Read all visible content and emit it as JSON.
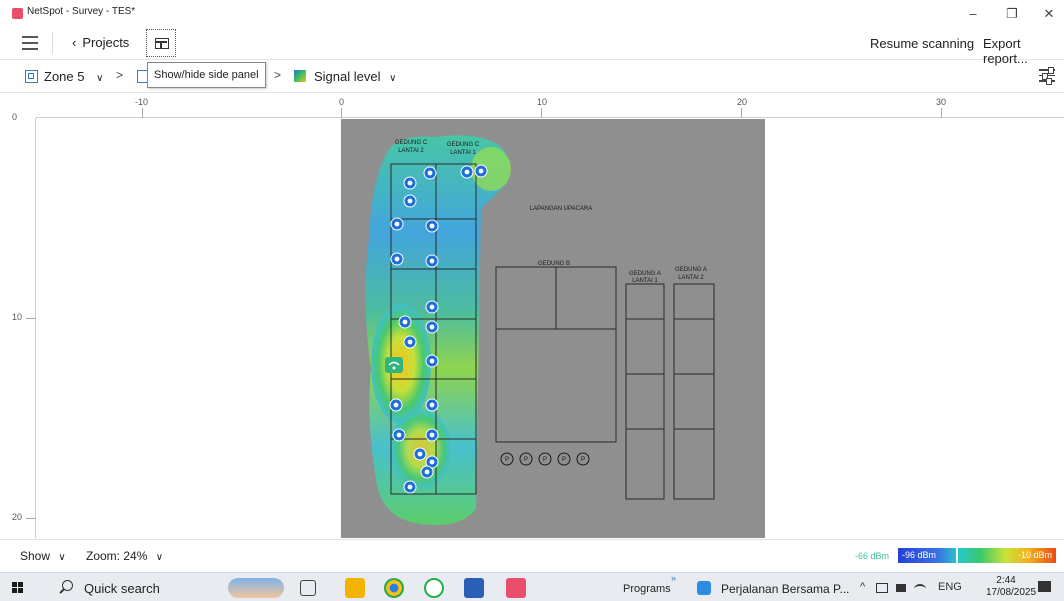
{
  "window": {
    "title": "NetSpot - Survey - TES*",
    "minimize_glyph": "–",
    "restore_glyph": "❐",
    "close_glyph": "✕"
  },
  "toolbar": {
    "projects_label": "Projects",
    "resume_label": "Resume scanning",
    "export_label": "Export report..."
  },
  "breadcrumb": {
    "zone_label": "Zone 5",
    "tooltip": "Show/hide side panel",
    "visualization_label": "Signal level"
  },
  "ruler": {
    "top_labels": [
      "-10",
      "0",
      "10",
      "20",
      "30"
    ],
    "left_labels": [
      "0",
      "10",
      "20"
    ]
  },
  "floorplan": {
    "labels": {
      "gedung_c_l2": [
        "GEDUNG C",
        "LANTAI 2"
      ],
      "gedung_c_l1": [
        "GEDUNG C",
        "LANTAI 1"
      ],
      "lapangan": "LAPANGAN UPACARA",
      "gedung_b": "GEDUNG B",
      "gedung_a_l1": [
        "GEDUNG A",
        "LANTAI 1"
      ],
      "gedung_a_l2": [
        "GEDUNG A",
        "LANTAI 2"
      ]
    },
    "parking_glyph": "P"
  },
  "status": {
    "show_label": "Show",
    "zoom_label": "Zoom: 24%",
    "legend_min": "-66 dBm",
    "legend_left": "-96 dBm",
    "legend_right": "-10 dBm"
  },
  "taskbar": {
    "search_label": "Quick search",
    "programs_label": "Programs",
    "programs_chevron": "»",
    "task_app_label": "Perjalanan Bersama P...",
    "tray_chevron": "^",
    "language": "ENG",
    "time": "2:44",
    "date": "17/08/2025"
  },
  "colors": {
    "accent": "#2a7bd1",
    "floor_bg": "#8f8f8f",
    "marker": "#1e6fd9"
  }
}
